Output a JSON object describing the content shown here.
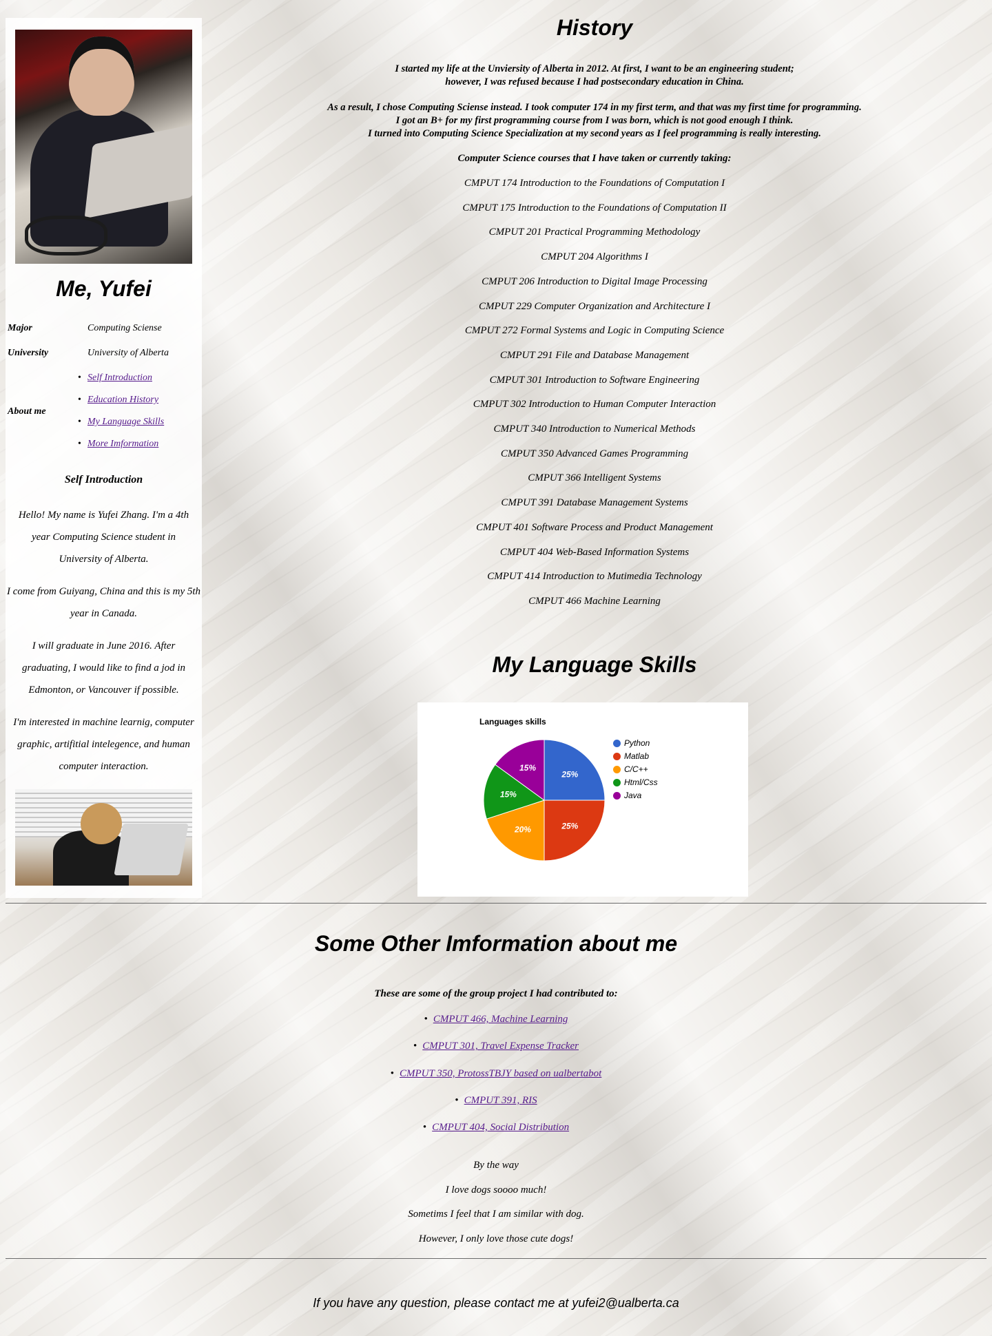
{
  "sidebar": {
    "title": "Me, Yufei",
    "major_label": "Major",
    "major_value": "Computing Sciense",
    "university_label": "University",
    "university_value": "University of Alberta",
    "about_label": "About me",
    "about_links": [
      "Self Introduction",
      "Education History",
      "My Language Skills",
      "More Imformation"
    ],
    "self_intro_heading": "Self Introduction",
    "paragraphs": [
      "Hello! My name is Yufei Zhang. I'm a 4th year Computing Science student in University of Alberta.",
      "I come from Guiyang, China and this is my 5th year in Canada.",
      "I will graduate in June 2016. After graduating, I would like to find a jod in Edmonton, or Vancouver if possible.",
      "I'm interested in machine learnig, computer graphic, artifitial intelegence, and human computer interaction."
    ]
  },
  "history": {
    "title": "History",
    "lines1": [
      "I started my life at the Unviersity of Alberta in 2012. At first, I want to be an engineering student;",
      "however, I was refused because I had postsecondary education in China."
    ],
    "lines2": [
      "As a result, I chose Computing Sciense instead. I took computer 174 in my first term, and that was my first time for programming.",
      "I got an B+ for my first programming course from I was born, which is not good enough I think.",
      "I turned into Computing Science Specialization at my second years as I feel programming is really interesting."
    ],
    "courses_heading": "Computer Science courses that I have taken or currently taking:",
    "courses": [
      "CMPUT 174 Introduction to the Foundations of Computation I",
      "CMPUT 175 Introduction to the Foundations of Computation II",
      "CMPUT 201 Practical Programming Methodology",
      "CMPUT 204 Algorithms I",
      "CMPUT 206 Introduction to Digital Image Processing",
      "CMPUT 229 Computer Organization and Architecture I",
      "CMPUT 272 Formal Systems and Logic in Computing Science",
      "CMPUT 291 File and Database Management",
      "CMPUT 301 Introduction to Software Engineering",
      "CMPUT 302 Introduction to Human Computer Interaction",
      "CMPUT 340 Introduction to Numerical Methods",
      "CMPUT 350 Advanced Games Programming",
      "CMPUT 366 Intelligent Systems",
      "CMPUT 391 Database Management Systems",
      "CMPUT 401 Software Process and Product Management",
      "CMPUT 404 Web-Based Information Systems",
      "CMPUT 414 Introduction to Mutimedia Technology",
      "CMPUT 466 Machine Learning"
    ]
  },
  "languages": {
    "title": "My Language Skills"
  },
  "chart_data": {
    "type": "pie",
    "title": "Languages skills",
    "categories": [
      "Python",
      "Matlab",
      "C/C++",
      "Html/Css",
      "Java"
    ],
    "values": [
      25,
      25,
      20,
      15,
      15
    ],
    "labels": [
      "25%",
      "25%",
      "20%",
      "15%",
      "15%"
    ],
    "colors": [
      "#3366cc",
      "#dc3912",
      "#ff9900",
      "#109618",
      "#990099"
    ],
    "legend": "right"
  },
  "other": {
    "title": "Some Other Imformation about me",
    "projects_intro": "These are some of the group project I had contributed to:",
    "projects": [
      "CMPUT 466, Machine Learning",
      "CMPUT 301, Travel Expense Tracker",
      "CMPUT 350, ProtossTBJY based on ualbertabot",
      "CMPUT 391, RIS",
      "CMPUT 404, Social Distribution"
    ],
    "by_the_way": [
      "By the way",
      "I love dogs soooo much!",
      "Sometims I feel that I am similar with dog.",
      "However, I only love those cute dogs!"
    ]
  },
  "contact": "If you have any question, please contact me at yufei2@ualberta.ca"
}
